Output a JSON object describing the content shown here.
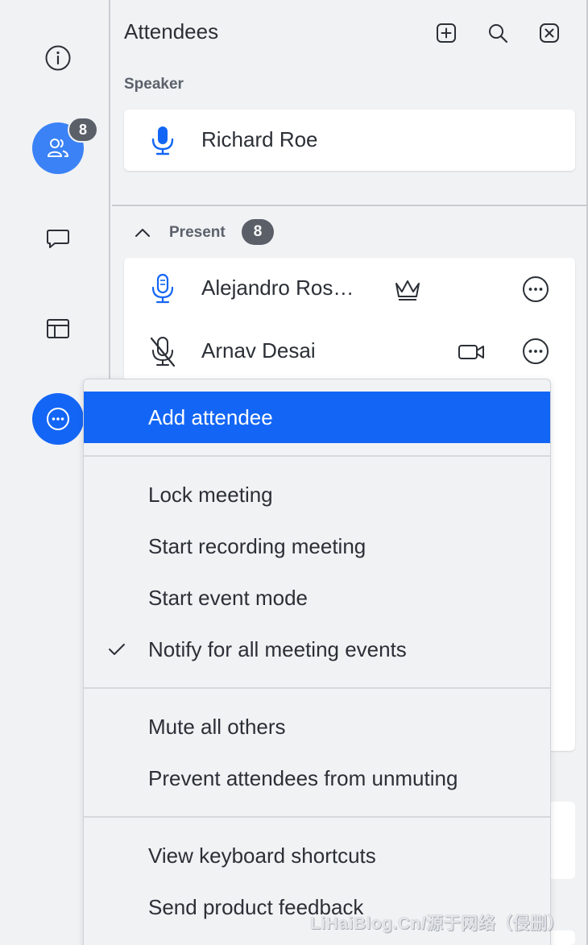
{
  "panel": {
    "title": "Attendees",
    "speaker_section": "Speaker",
    "speaker": {
      "name": "Richard Roe"
    },
    "present_section": "Present",
    "present_count": "8",
    "attendees": [
      {
        "name": "Alejandro Ros…"
      },
      {
        "name": "Arnav Desai"
      }
    ]
  },
  "rail": {
    "attendees_badge": "8"
  },
  "menu": {
    "items": [
      "Add attendee",
      "Lock meeting",
      "Start recording meeting",
      "Start event mode",
      "Notify for all meeting events",
      "Mute all others",
      "Prevent attendees from unmuting",
      "View keyboard shortcuts",
      "Send product feedback"
    ]
  },
  "watermark": "LiHaiBlog.Cn/源于网络（侵删）",
  "colors": {
    "accent": "#1366f5",
    "active_rail": "#3b82f6",
    "badge": "#5a5f68",
    "mic_blue": "#1366f5"
  },
  "icons": {
    "rail": [
      "info-icon",
      "people-icon",
      "chat-icon",
      "layout-icon",
      "more-icon"
    ],
    "header": [
      "add-icon",
      "search-icon",
      "close-icon"
    ]
  }
}
